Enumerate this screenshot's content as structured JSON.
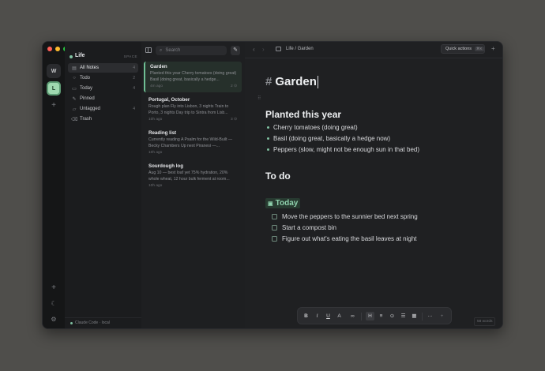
{
  "window": {
    "traffic_lights": [
      "#ff5f57",
      "#febc2e",
      "#28c840"
    ]
  },
  "rail": {
    "spaces": [
      {
        "letter": "W"
      },
      {
        "letter": "L",
        "active": true
      }
    ],
    "add": "+",
    "bottom": [
      "+",
      "☾",
      "⚙"
    ]
  },
  "sidebar": {
    "space_name": "Life",
    "space_label": "SPACE",
    "items": [
      {
        "icon": "▤",
        "label": "All Notes",
        "count": "4",
        "active": true
      },
      {
        "icon": "○",
        "label": "Todo",
        "count": "2"
      },
      {
        "icon": "▭",
        "label": "Today",
        "count": "4"
      },
      {
        "icon": "✎",
        "label": "Pinned",
        "count": ""
      },
      {
        "icon": "▱",
        "label": "Untagged",
        "count": "4"
      },
      {
        "icon": "🗑",
        "label": "Trash",
        "count": ""
      }
    ],
    "footer": "Claude Code · local"
  },
  "notes": {
    "search_placeholder": "Search",
    "items": [
      {
        "title": "Garden",
        "preview": "Planted this year Cherry tomatoes (doing great) Basil (doing great, basically a hedge...",
        "meta": "4m ago",
        "badge": "2 ⊙",
        "active": true
      },
      {
        "title": "Portugal, October",
        "preview": "Rough plan Fly into Lisbon, 3 nights Train to Porto, 3 nights Day trip to Sintra from Lisb...",
        "meta": "10h ago",
        "badge": "3 ⊙"
      },
      {
        "title": "Reading list",
        "preview": "Currently reading A Psalm for the Wild-Built — Becky Chambers Up next Piranesi —...",
        "meta": "10h ago",
        "badge": ""
      },
      {
        "title": "Sourdough log",
        "preview": "Aug 10 — best loaf yet 75% hydration, 20% whole wheat, 12 hour bulk ferment at room...",
        "meta": "10h ago",
        "badge": ""
      }
    ]
  },
  "editor": {
    "breadcrumb": "Life / Garden",
    "quick_actions": "Quick actions",
    "quick_actions_kbd": "⌘K",
    "title_hash": "#",
    "title": "Garden",
    "section1": "Planted this year",
    "bullets": [
      "Cherry tomatoes (doing great)",
      "Basil (doing great, basically a hedge now)",
      "Peppers (slow, might not be enough sun in that bed)"
    ],
    "section2": "To do",
    "today_label": "Today",
    "tasks": [
      "Move the peppers to the sunnier bed next spring",
      "Start a compost bin",
      "Figure out what's eating the basil leaves at night"
    ],
    "word_count": "58 words",
    "toolbar": [
      "B",
      "I",
      "U",
      "A",
      "🔗",
      "H",
      "≡",
      "⊙",
      "☰",
      "▦",
      "···",
      "+"
    ]
  }
}
